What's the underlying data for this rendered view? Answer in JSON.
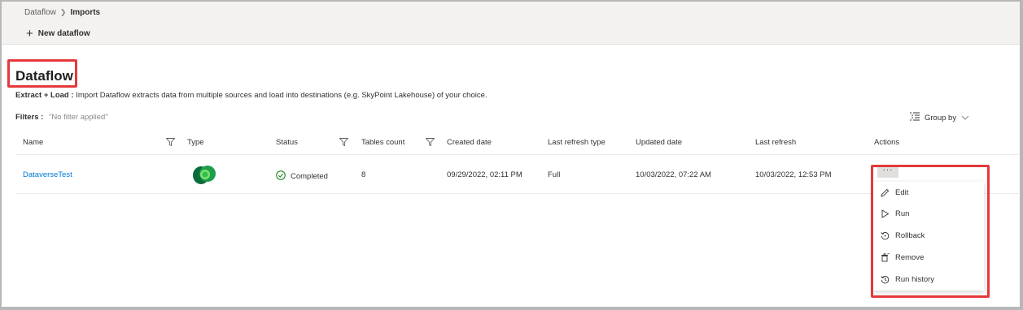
{
  "breadcrumb": {
    "root": "Dataflow",
    "current": "Imports"
  },
  "toolbar": {
    "new_dataflow": "New dataflow"
  },
  "page": {
    "title": "Dataflow",
    "desc_bold": "Extract + Load :",
    "desc_text": "Import Dataflow extracts data from multiple sources and load into destinations (e.g. SkyPoint Lakehouse) of your choice.",
    "filters_label": "Filters :",
    "filters_value": "\"No filter applied\"",
    "group_by": "Group by"
  },
  "table": {
    "headers": {
      "name": "Name",
      "type": "Type",
      "status": "Status",
      "tables_count": "Tables count",
      "created_date": "Created date",
      "last_refresh_type": "Last refresh type",
      "updated_date": "Updated date",
      "last_refresh": "Last refresh",
      "actions": "Actions"
    },
    "rows": [
      {
        "name": "DataverseTest",
        "type_icon": "dataverse-icon",
        "status": "Completed",
        "tables_count": "8",
        "created_date": "09/29/2022, 02:11 PM",
        "last_refresh_type": "Full",
        "updated_date": "10/03/2022, 07:22 AM",
        "last_refresh": "10/03/2022, 12:53 PM",
        "actions": "···"
      }
    ]
  },
  "menu": {
    "items": [
      {
        "label": "Edit",
        "icon": "pencil-icon"
      },
      {
        "label": "Run",
        "icon": "play-icon"
      },
      {
        "label": "Rollback",
        "icon": "rollback-icon"
      },
      {
        "label": "Remove",
        "icon": "trash-icon"
      },
      {
        "label": "Run history",
        "icon": "history-icon"
      }
    ]
  },
  "colors": {
    "accent": "#0078d4",
    "highlight": "#e5393c",
    "success": "#107c10"
  }
}
